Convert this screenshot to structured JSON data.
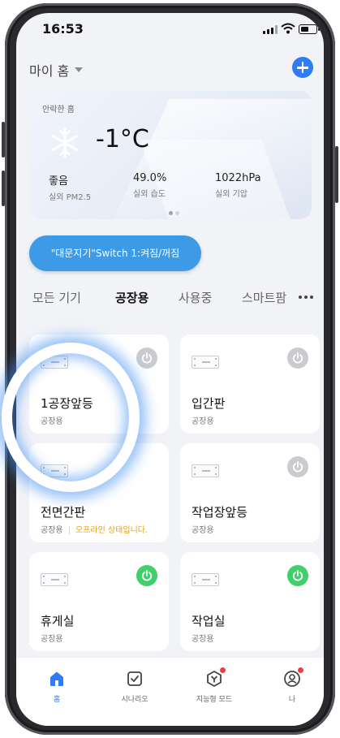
{
  "status_bar": {
    "time": "16:53"
  },
  "header": {
    "home_name": "마이 홈"
  },
  "weather": {
    "location": "안락한 홈",
    "temperature": "-1°C",
    "stats": [
      {
        "value": "좋음",
        "label": "실외 PM2.5"
      },
      {
        "value": "49.0%",
        "label": "실외 습도"
      },
      {
        "value": "1022hPa",
        "label": "실외 기압"
      }
    ]
  },
  "scene_chip": {
    "label": "\"대문지기\"Switch 1:켜짐/꺼짐"
  },
  "tabs": [
    {
      "label": "모든 기기",
      "active": false
    },
    {
      "label": "공장용",
      "active": true
    },
    {
      "label": "사용중",
      "active": false
    },
    {
      "label": "스마트팜",
      "active": false
    }
  ],
  "devices": [
    {
      "name": "1공장앞등",
      "room": "공장용",
      "power": "off"
    },
    {
      "name": "입간판",
      "room": "공장용",
      "power": "off"
    },
    {
      "name": "전면간판",
      "room": "공장용",
      "status": "오프라인 상태입니다.",
      "power": "none"
    },
    {
      "name": "작업장앞등",
      "room": "공장용",
      "power": "off"
    },
    {
      "name": "휴게실",
      "room": "공장용",
      "power": "on"
    },
    {
      "name": "작업실",
      "room": "공장용",
      "power": "on"
    }
  ],
  "tab_bar": [
    {
      "label": "홈",
      "icon": "home-icon",
      "active": true
    },
    {
      "label": "시나리오",
      "icon": "scenario-icon",
      "active": false
    },
    {
      "label": "지능형 모드",
      "icon": "smart-mode-icon",
      "active": false
    },
    {
      "label": "나",
      "icon": "profile-icon",
      "active": false
    }
  ],
  "colors": {
    "accent": "#2f7cf6",
    "scene_chip": "#3d9ae6",
    "power_on": "#3fcf6d",
    "power_off": "#c9cbcf",
    "warning": "#e0a21b",
    "notification": "#ee3f3f"
  }
}
